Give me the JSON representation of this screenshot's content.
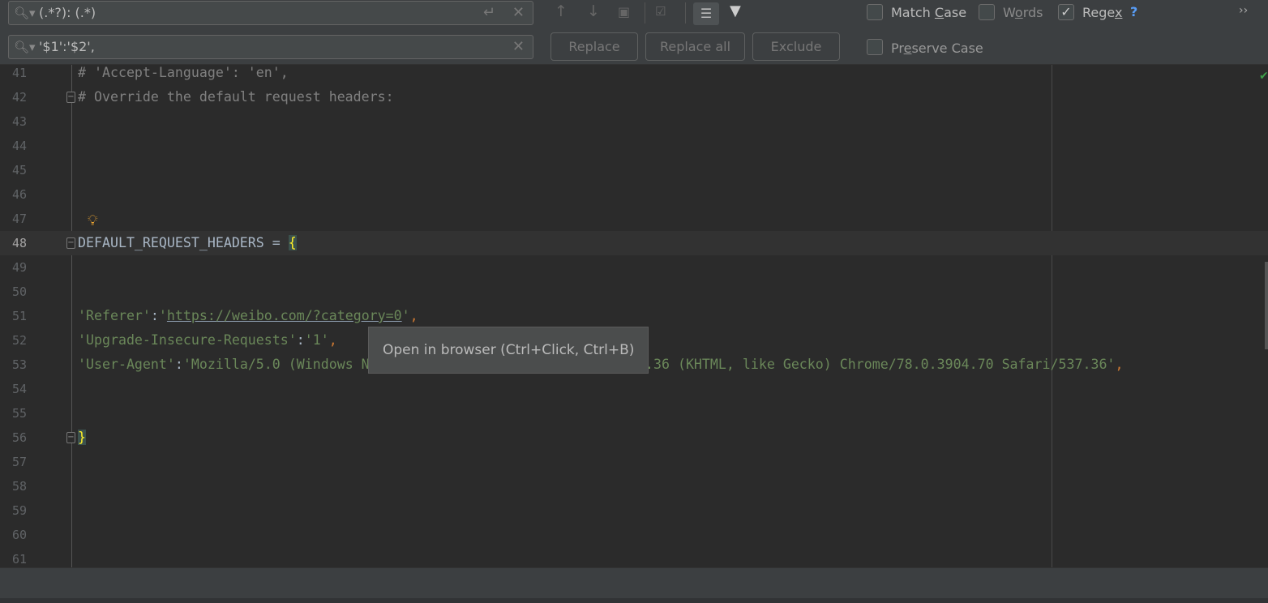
{
  "find_bar": {
    "search_value": "(.*?): (.*)",
    "replace_value": "'$1':'$2',",
    "replace_label": "Replace",
    "replace_all_label": "Replace all",
    "exclude_label": "Exclude",
    "options": {
      "match_case": {
        "label_pre": "Match ",
        "label_u": "C",
        "label_post": "ase",
        "checked": false
      },
      "words": {
        "label_pre": "W",
        "label_u": "o",
        "label_post": "rds",
        "checked": false
      },
      "regex": {
        "label_pre": "Rege",
        "label_u": "x",
        "label_post": "",
        "checked": true,
        "help": "?"
      },
      "preserve_case": {
        "label_pre": "Pr",
        "label_u": "e",
        "label_post": "serve Case",
        "checked": false
      }
    },
    "more": "››"
  },
  "editor": {
    "lines": [
      {
        "n": "41",
        "text": "# 'Accept-Language': 'en',"
      },
      {
        "n": "42",
        "text": "# Override the default request headers:"
      },
      {
        "n": "43",
        "text": ""
      },
      {
        "n": "44",
        "text": ""
      },
      {
        "n": "45",
        "text": ""
      },
      {
        "n": "46",
        "text": ""
      },
      {
        "n": "47",
        "text": ""
      },
      {
        "n": "48",
        "text": "DEFAULT_REQUEST_HEADERS = ",
        "brace": "{"
      },
      {
        "n": "49",
        "text": ""
      },
      {
        "n": "50",
        "text": ""
      },
      {
        "n": "51",
        "key": "'Referer'",
        "colon": ":",
        "q1": "'",
        "url": "https://weibo.com/?category=0",
        "q2": "'",
        "comma": ","
      },
      {
        "n": "52",
        "key": "'Upgrade-Insecure-Requests'",
        "colon": ":",
        "val": "'1'",
        "comma": ","
      },
      {
        "n": "53",
        "key": "'User-Agent'",
        "colon": ":",
        "val": "'Mozilla/5.0 (Windows N",
        "val_tail": "7.36 (KHTML, like Gecko) Chrome/78.0.3904.70 Safari/537.36'",
        "comma": ","
      },
      {
        "n": "54",
        "text": ""
      },
      {
        "n": "55",
        "text": ""
      },
      {
        "n": "56",
        "brace": "}"
      },
      {
        "n": "57"
      },
      {
        "n": "58"
      },
      {
        "n": "59"
      },
      {
        "n": "60"
      },
      {
        "n": "61"
      }
    ]
  },
  "tooltip": "Open in browser (Ctrl+Click, Ctrl+B)"
}
